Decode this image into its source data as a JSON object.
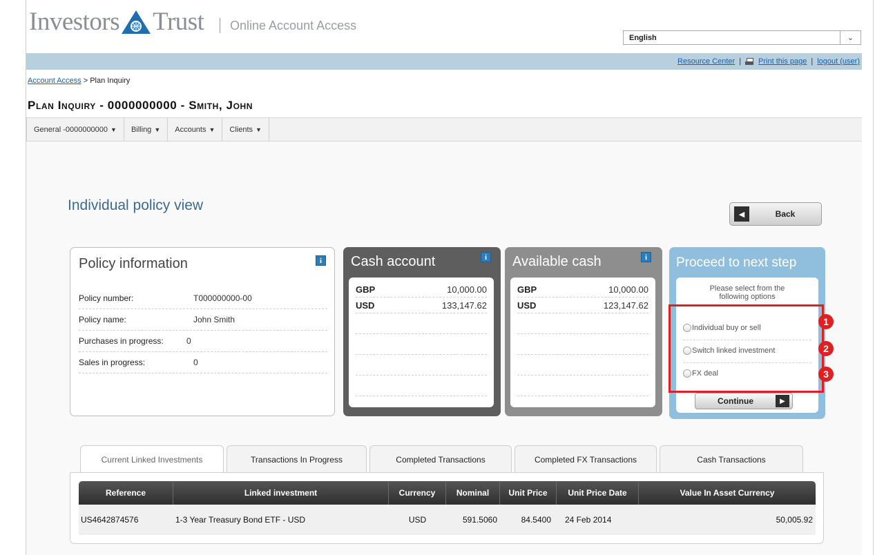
{
  "header": {
    "logo_left": "Investors",
    "logo_right": "Trust",
    "tagline": "Online Account Access",
    "language": {
      "selected": "English"
    },
    "links": {
      "resource_center": "Resource Center",
      "print": "Print this page",
      "logout": "logout (user)"
    },
    "breadcrumb": {
      "link": "Account Access",
      "separator": ">",
      "current": "Plan Inquiry"
    },
    "page_title": "Plan Inquiry - 0000000000 - Smith, John"
  },
  "menu": [
    {
      "label": "General -0000000000"
    },
    {
      "label": "Billing"
    },
    {
      "label": "Accounts"
    },
    {
      "label": "Clients"
    }
  ],
  "section": {
    "title": "Individual policy view",
    "back_label": "Back"
  },
  "policy": {
    "title": "Policy information",
    "rows": [
      {
        "label": "Policy number:",
        "value": "T000000000-00"
      },
      {
        "label": "Policy name:",
        "value": "John Smith"
      },
      {
        "label": "Purchases in progress:",
        "value": "0"
      },
      {
        "label": "Sales in progress:",
        "value": "0"
      }
    ]
  },
  "cash_account": {
    "title": "Cash account",
    "rows": [
      {
        "currency": "GBP",
        "amount": "10,000.00"
      },
      {
        "currency": "USD",
        "amount": "133,147.62"
      }
    ]
  },
  "available_cash": {
    "title": "Available cash",
    "rows": [
      {
        "currency": "GBP",
        "amount": "10,000.00"
      },
      {
        "currency": "USD",
        "amount": "123,147.62"
      }
    ]
  },
  "next_step": {
    "title": "Proceed to next step",
    "instruction": "Please select from the following options",
    "options": [
      {
        "label": "Individual buy or sell",
        "marker": "1"
      },
      {
        "label": "Switch linked investment",
        "marker": "2"
      },
      {
        "label": "FX deal",
        "marker": "3"
      }
    ],
    "continue_label": "Continue"
  },
  "tabs": [
    {
      "label": "Current Linked Investments"
    },
    {
      "label": "Transactions In Progress"
    },
    {
      "label": "Completed Transactions"
    },
    {
      "label": "Completed FX Transactions"
    },
    {
      "label": "Cash Transactions"
    }
  ],
  "table": {
    "columns": [
      "Reference",
      "Linked investment",
      "Currency",
      "Nominal",
      "Unit Price",
      "Unit Price Date",
      "Value In Asset Currency"
    ],
    "rows": [
      [
        "US4642874576",
        "1-3 Year Treasury Bond ETF - USD",
        "USD",
        "591.5060",
        "84.5400",
        "24 Feb 2014",
        "50,005.92"
      ]
    ]
  },
  "colors": {
    "accent_blue": "#3d6b8e",
    "highlight_red": "#e02020",
    "next_step_blue": "#8fbfdc"
  }
}
